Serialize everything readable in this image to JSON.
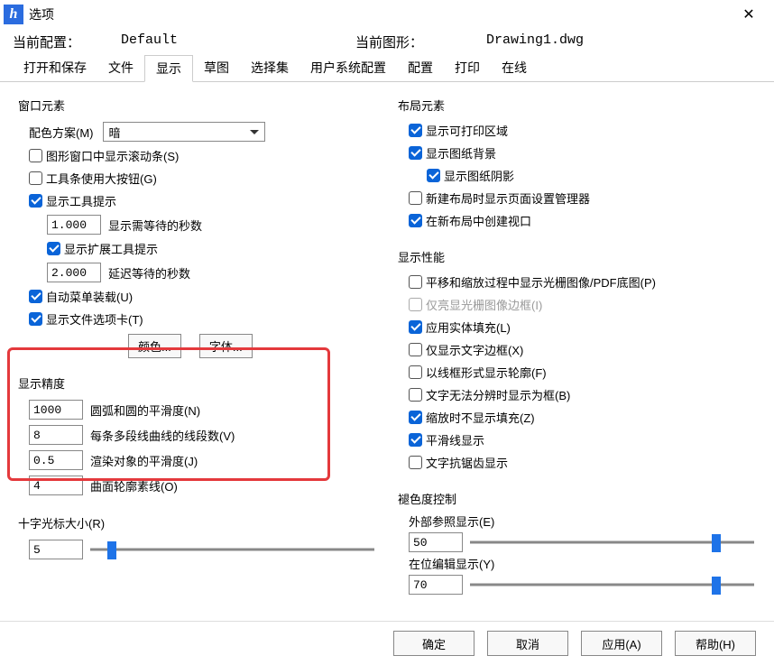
{
  "title": "选项",
  "config": {
    "label_current_config": "当前配置：",
    "current_config_value": "Default",
    "label_current_drawing": "当前图形：",
    "current_drawing_value": "Drawing1.dwg"
  },
  "tabs": {
    "t0": "打开和保存",
    "t1": "文件",
    "t2": "显示",
    "t3": "草图",
    "t4": "选择集",
    "t5": "用户系统配置",
    "t6": "配置",
    "t7": "打印",
    "t8": "在线"
  },
  "left": {
    "window_elements_title": "窗口元素",
    "color_scheme_label": "配色方案(M)",
    "color_scheme_value": "暗",
    "show_scrollbars": "图形窗口中显示滚动条(S)",
    "large_buttons": "工具条使用大按钮(G)",
    "show_tooltips": "显示工具提示",
    "tooltip_delay_value": "1.000",
    "tooltip_delay_label": "显示需等待的秒数",
    "show_ext_tooltips": "显示扩展工具提示",
    "ext_tooltip_delay_value": "2.000",
    "ext_tooltip_delay_label": "延迟等待的秒数",
    "auto_menu_load": "自动菜单装载(U)",
    "show_file_tabs": "显示文件选项卡(T)",
    "btn_color": "颜色...",
    "btn_font": "字体...",
    "precision_title": "显示精度",
    "arc_smooth_value": "1000",
    "arc_smooth_label": "圆弧和圆的平滑度(N)",
    "polyline_seg_value": "8",
    "polyline_seg_label": "每条多段线曲线的线段数(V)",
    "render_smooth_value": "0.5",
    "render_smooth_label": "渲染对象的平滑度(J)",
    "contour_value": "4",
    "contour_label": "曲面轮廓素线(O)",
    "crosshair_title": "十字光标大小(R)",
    "crosshair_value": "5"
  },
  "right": {
    "layout_title": "布局元素",
    "show_print_area": "显示可打印区域",
    "show_paper_bg": "显示图纸背景",
    "show_paper_shadow": "显示图纸阴影",
    "show_page_setup": "新建布局时显示页面设置管理器",
    "create_viewport": "在新布局中创建视口",
    "perf_title": "显示性能",
    "pan_zoom_raster": "平移和缩放过程中显示光栅图像/PDF底图(P)",
    "highlight_raster_frame": "仅亮显光栅图像边框(I)",
    "apply_solid_fill": "应用实体填充(L)",
    "text_frame_only": "仅显示文字边框(X)",
    "wireframe_silhouette": "以线框形式显示轮廓(F)",
    "text_as_box": "文字无法分辨时显示为框(B)",
    "no_fill_on_zoom": "缩放时不显示填充(Z)",
    "smooth_line": "平滑线显示",
    "text_antialias": "文字抗锯齿显示",
    "fade_title": "褪色度控制",
    "xref_label": "外部参照显示(E)",
    "xref_value": "50",
    "inplace_label": "在位编辑显示(Y)",
    "inplace_value": "70"
  },
  "footer": {
    "ok": "确定",
    "cancel": "取消",
    "apply": "应用(A)",
    "help": "帮助(H)"
  }
}
